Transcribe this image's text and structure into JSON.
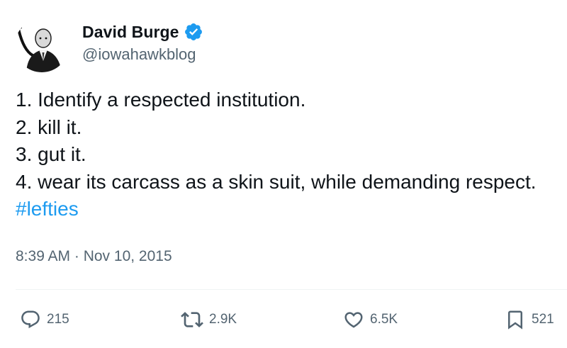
{
  "author": {
    "display_name": "David Burge",
    "handle": "@iowahawkblog",
    "verified": true
  },
  "tweet": {
    "lines": [
      "1. Identify a respected institution.",
      "2. kill it.",
      "3. gut it.",
      "4. wear its carcass as a skin suit, while demanding respect."
    ],
    "hashtag": "#lefties",
    "timestamp": "8:39 AM · Nov 10, 2015"
  },
  "stats": {
    "replies": "215",
    "retweets": "2.9K",
    "likes": "6.5K",
    "bookmarks": "521"
  },
  "icons": {
    "verified": "verified-badge-icon",
    "reply": "reply-icon",
    "retweet": "retweet-icon",
    "like": "heart-icon",
    "bookmark": "bookmark-icon"
  },
  "colors": {
    "text": "#0f1419",
    "secondary": "#536471",
    "link": "#1d9bf0",
    "verified": "#1d9bf0",
    "divider": "#eff3f4"
  }
}
